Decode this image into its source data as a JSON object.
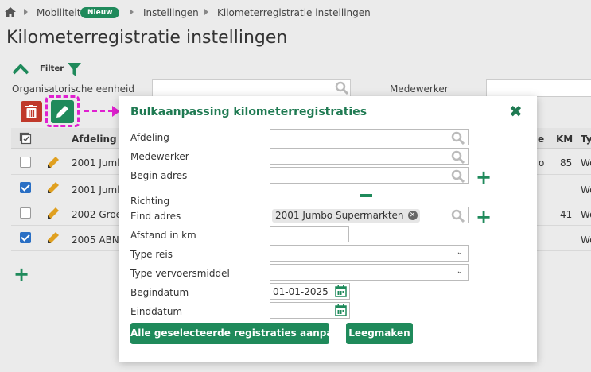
{
  "breadcrumb": {
    "items": [
      "Mobiliteit",
      "Instellingen",
      "Kilometerregistratie instellingen"
    ],
    "badge": "Nieuw"
  },
  "page_title": "Kilometerregistratie instellingen",
  "filter": {
    "label": "Filter",
    "org_unit_label": "Organisatorische eenheid",
    "employee_label": "Medewerker"
  },
  "table": {
    "headers": [
      "Afdeling",
      "e",
      "KM",
      "Ty"
    ],
    "rows": [
      {
        "checked": false,
        "afdeling": "2001 Jumb",
        "e": "o",
        "km": "85",
        "ty": "Wo"
      },
      {
        "checked": true,
        "afdeling": "2001 Jumb",
        "e": "",
        "km": "",
        "ty": "Wo"
      },
      {
        "checked": false,
        "afdeling": "2002 Groe",
        "e": "",
        "km": "41",
        "ty": "Wo"
      },
      {
        "checked": true,
        "afdeling": "2005 ABN",
        "e": "",
        "km": "",
        "ty": "Wo"
      }
    ]
  },
  "modal": {
    "title": "Bulkaanpassing kilometerregistraties",
    "fields": {
      "afdeling": "Afdeling",
      "medewerker": "Medewerker",
      "begin_adres": "Begin adres",
      "richting": "Richting",
      "eind_adres": "Eind adres",
      "afstand": "Afstand in km",
      "type_reis": "Type reis",
      "type_vervoer": "Type vervoersmiddel",
      "begindatum": "Begindatum",
      "einddatum": "Einddatum"
    },
    "eind_adres_chip": "2001 Jumbo Supermarkten",
    "begindatum_value": "01-01-2025",
    "apply_button": "Alle geselecteerde registraties aanpassen",
    "clear_button": "Leegmaken"
  },
  "colors": {
    "accent": "#1f8a5b",
    "highlight": "#e020d0",
    "delete": "#c0392b",
    "checkbox": "#2a6fc4"
  },
  "icons": [
    "home-icon",
    "chevron-up-icon",
    "filter-icon",
    "trash-icon",
    "pencil-icon",
    "search-icon",
    "calendar-icon",
    "plus-icon",
    "minus-icon",
    "close-icon"
  ]
}
